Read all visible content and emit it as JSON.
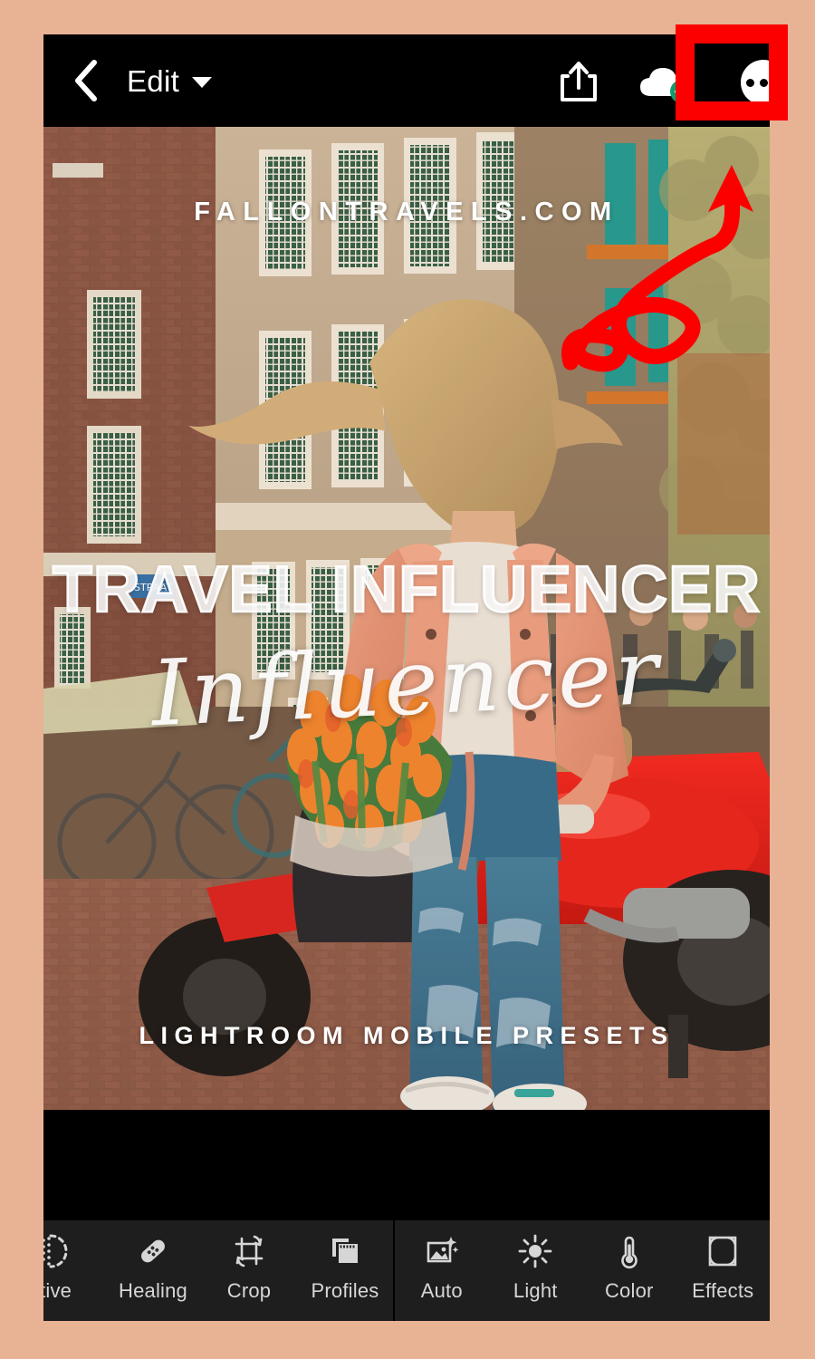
{
  "background_color": "#e8b295",
  "annotation": {
    "highlight_color": "#fc0000",
    "target": "more-options-button",
    "box_label": "red-highlight-box",
    "arrow_label": "red-curly-arrow"
  },
  "appbar": {
    "background_color": "#000000",
    "back_icon": "back-chevron-icon",
    "title": "Edit",
    "title_caret": "chevron-down-icon",
    "share_icon": "share-upload-icon",
    "cloud_icon": "cloud-synced-icon",
    "cloud_badge_color": "#0f9d70",
    "more_icon": "more-horizontal-icon"
  },
  "photo": {
    "alt": "Woman in peach jacket holding orange tulips beside a red Vespa scooter on an Amsterdam street",
    "overlays": {
      "website": "FALLONTRAVELS.COM",
      "title": "TRAVEL INFLUENCER",
      "script": "Influencer",
      "subtitle": "LIGHTROOM MOBILE PRESETS"
    }
  },
  "toolbar": {
    "background_color": "#1e1e1e",
    "label_color": "#d6d6d6",
    "groups": [
      {
        "name": "edit-tools",
        "items": [
          {
            "label": "ctive",
            "full_label": "Selective",
            "icon": "selective-dots-icon",
            "truncated": true
          },
          {
            "label": "Healing",
            "icon": "healing-bandage-icon",
            "truncated": false
          },
          {
            "label": "Crop",
            "icon": "crop-rotate-icon",
            "truncated": false
          },
          {
            "label": "Profiles",
            "icon": "profiles-stack-icon",
            "truncated": false
          }
        ]
      },
      {
        "name": "adjust-tools",
        "items": [
          {
            "label": "Auto",
            "icon": "auto-sparkle-image-icon",
            "truncated": false
          },
          {
            "label": "Light",
            "icon": "sun-icon",
            "truncated": false
          },
          {
            "label": "Color",
            "icon": "thermometer-icon",
            "truncated": false
          },
          {
            "label": "Effects",
            "icon": "vignette-frame-icon",
            "truncated": false
          }
        ]
      }
    ]
  }
}
